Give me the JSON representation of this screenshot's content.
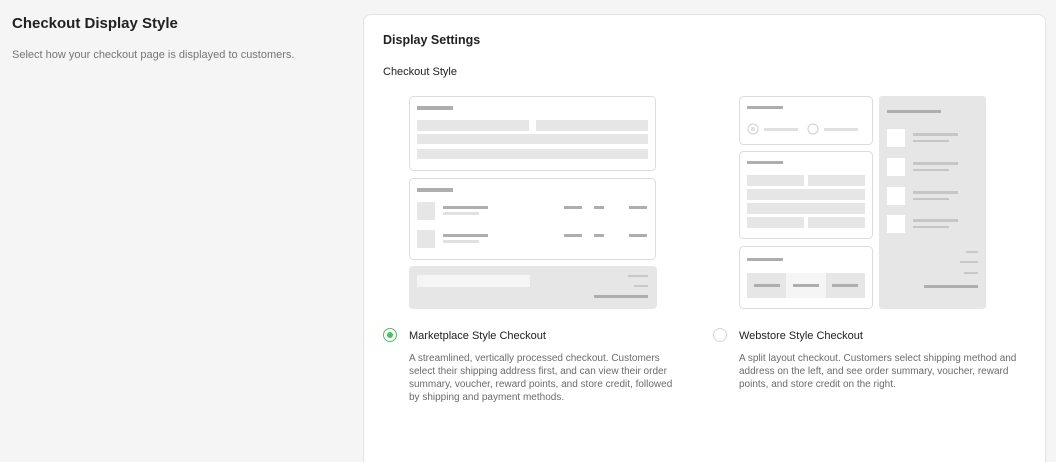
{
  "section": {
    "title": "Checkout Display Style",
    "description": "Select how your checkout page is displayed to customers."
  },
  "card": {
    "title": "Display Settings",
    "field_label": "Checkout Style"
  },
  "options": [
    {
      "title": "Marketplace Style Checkout",
      "description": "A streamlined, vertically processed checkout. Customers select their shipping address first, and can view their order summary, voucher, reward points, and store credit, followed by shipping and payment methods.",
      "selected": true
    },
    {
      "title": "Webstore Style Checkout",
      "description": "A split layout checkout. Customers select shipping method and address on the left, and see order summary, voucher, reward points, and store credit on the right.",
      "selected": false
    }
  ],
  "colors": {
    "accent": "#4cbf62",
    "card_border": "#e3e3e3",
    "illustration_bar": "#e6e6e6",
    "illustration_dark": "#aeaeae"
  }
}
